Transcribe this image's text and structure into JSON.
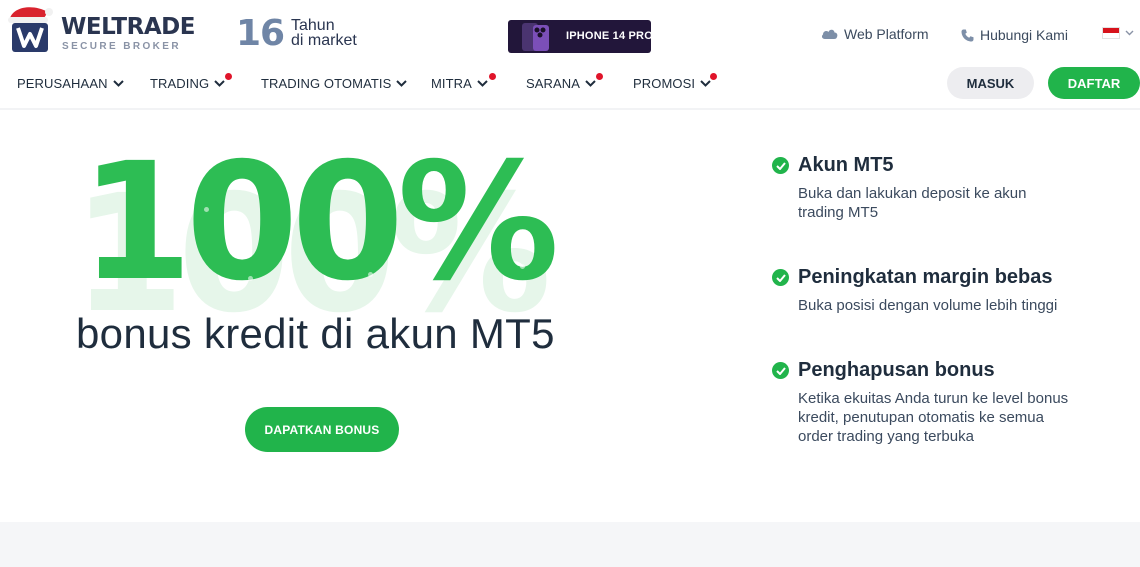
{
  "brand": {
    "name": "WELTRADE",
    "tagline": "SECURE BROKER",
    "years_number": "16",
    "years_label_1": "Tahun",
    "years_label_2": "di market"
  },
  "promo_banner": {
    "label": "IPHONE 14 PRO"
  },
  "header_links": {
    "web_platform": "Web Platform",
    "contact": "Hubungi Kami"
  },
  "nav": {
    "items": [
      {
        "label": "PERUSAHAAN",
        "has_dot": false
      },
      {
        "label": "TRADING",
        "has_dot": true
      },
      {
        "label": "TRADING OTOMATIS",
        "has_dot": false
      },
      {
        "label": "MITRA",
        "has_dot": true
      },
      {
        "label": "SARANA",
        "has_dot": true
      },
      {
        "label": "PROMOSI",
        "has_dot": true
      }
    ],
    "login_label": "MASUK",
    "register_label": "DAFTAR"
  },
  "hero": {
    "headline": "100%",
    "subheadline": "bonus kredit di akun MT5",
    "cta_label": "DAPATKAN BONUS"
  },
  "features": [
    {
      "title": "Akun MT5",
      "description": "Buka dan lakukan deposit ke akun trading MT5"
    },
    {
      "title": "Peningkatan margin bebas",
      "description": "Buka posisi dengan volume lebih tinggi"
    },
    {
      "title": "Penghapusan bonus",
      "description": "Ketika ekuitas Anda turun ke level bonus kredit, penutupan otomatis ke semua order trading yang terbuka"
    }
  ],
  "colors": {
    "accent_green": "#21b44b",
    "headline_green": "#2dbd54",
    "notification_dot": "#e0142a",
    "text_dark": "#1f2d3d",
    "promo_bg": "#22163a"
  },
  "icons": {
    "web_platform": "cloud-icon",
    "contact": "phone-icon",
    "language": "flag-indonesia-icon",
    "nav_dropdown": "chevron-down-icon",
    "feature_bullet": "check-circle-icon"
  }
}
